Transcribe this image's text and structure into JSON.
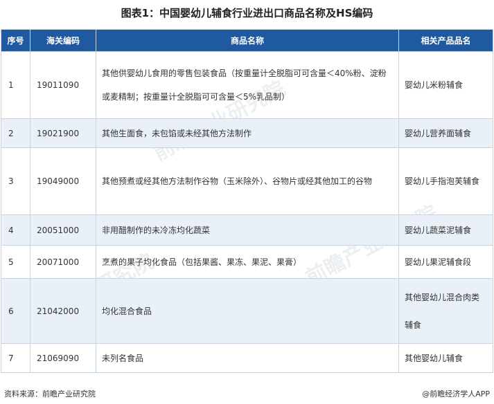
{
  "title": "图表1：中国婴幼儿辅食行业进出口商品名称及HS编码",
  "headers": [
    "序号",
    "海关编码",
    "商品名称",
    "相关产品品名"
  ],
  "rows": [
    {
      "idx": "1",
      "code": "19011090",
      "name": "其他供婴幼儿食用的零售包装食品（按重量计全脱脂可可含量＜40%粉、淀粉或麦精制；按重量计全脱脂可可含量＜5%乳品制）",
      "product": "婴幼儿米粉辅食"
    },
    {
      "idx": "2",
      "code": "19021900",
      "name": "其他生面食，未包馅或未经其他方法制作",
      "product": "婴幼儿营养面辅食"
    },
    {
      "idx": "3",
      "code": "19049000",
      "name": "其他预煮或经其他方法制作谷物（玉米除外）、谷物片或经其他加工的谷物",
      "product": "婴幼儿手指泡芙辅食"
    },
    {
      "idx": "4",
      "code": "20051000",
      "name": "非用醋制作的未冷冻均化蔬菜",
      "product": "婴幼儿蔬菜泥辅食"
    },
    {
      "idx": "5",
      "code": "20071000",
      "name": "烹煮的果子均化食品（包括果酱、果冻、果泥、果膏）",
      "product": "婴幼儿果泥辅食段"
    },
    {
      "idx": "6",
      "code": "21042000",
      "name": "均化混合食品",
      "product": "其他婴幼儿混合肉类辅食"
    },
    {
      "idx": "7",
      "code": "21069090",
      "name": "未列名食品",
      "product": "其他婴幼儿辅食"
    }
  ],
  "footer": {
    "source": "资料来源：前瞻产业研究院",
    "brand": "@前瞻经济学人APP"
  },
  "colors": {
    "header_bg": "#1f5aa0",
    "alt_row_bg": "#eaf0f7"
  },
  "icons": {
    "brand": "search-icon"
  }
}
